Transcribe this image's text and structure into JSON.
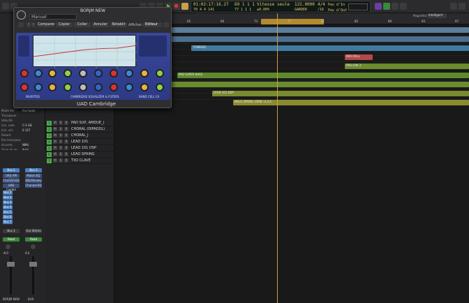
{
  "control_bar": {
    "lcd_time": "01:02:17:16.27",
    "lcd_time_sub": "70 4 4 141",
    "lcd_bars": "69 1 1 1",
    "lcd_bars_sub": "77 1 1 1",
    "lcd_mode": "Vitesse seule",
    "lcd_mode_sub": "±0.00%",
    "lcd_tempo": "122.0000",
    "lcd_tempo_sub": "GARDER",
    "lcd_sig": "4/4",
    "lcd_sig_sub": "/16",
    "lcd_in": "Pas d'In",
    "lcd_out": "Pas d'Out",
    "snap_label": "Magnétisme",
    "snap_value": "Intelligent"
  },
  "plugin": {
    "preset_name": "Manuel",
    "top_title": "BORJM NEW",
    "menu": [
      "Comparer",
      "Copier",
      "Coller",
      "Annuler",
      "Rétablir"
    ],
    "view_label": "Afficher :",
    "view_value": "Éditeur",
    "brand": "UAD Cambridge",
    "badge_1": "INVERTED",
    "badge_2": "CAMBRIDGE EQUALIZER & FILTERS",
    "badge_3": "BAND CELL CA",
    "knob_colors": [
      "#d33",
      "#3a8ad8",
      "#e7b341",
      "#8fd14f",
      "#bcbcbc",
      "#36c",
      "#d33",
      "#3a8ad8",
      "#e7b341",
      "#8fd14f"
    ]
  },
  "inspector": {
    "rows": [
      {
        "label": "Mode Vel",
        "value": "Pro-Fader"
      },
      {
        "label": "Transposer",
        "value": ""
      },
      {
        "label": "Vélocité",
        "value": ""
      },
      {
        "label": "Lim. note",
        "value": "C-2 G8"
      },
      {
        "label": "Lim. vél.",
        "value": "0 127"
      },
      {
        "label": "Retard",
        "value": ""
      },
      {
        "label": "Pas transpose",
        "value": ""
      },
      {
        "label": "Accords",
        "value": "NMU"
      },
      {
        "label": "Style de jeu",
        "value": "Auto"
      },
      {
        "label": "Arr. de tenue",
        "value": ""
      }
    ]
  },
  "tracks": [
    {
      "num": "1",
      "name": "PAD SUP, AMDUE_)"
    },
    {
      "num": "2",
      "name": "CHORAL (DIPADDL)"
    },
    {
      "num": "3",
      "name": "CHORAL_J"
    },
    {
      "num": "4",
      "name": "LEAD 101"
    },
    {
      "num": "5",
      "name": "LEAD 101 DSP"
    },
    {
      "num": "6",
      "name": "LEAD SPRING"
    },
    {
      "num": "7",
      "name": "TXO CLAVE"
    }
  ],
  "ruler": [
    "57",
    "61",
    "65",
    "69",
    "73",
    "77",
    "81",
    "85",
    "89",
    "93",
    "97"
  ],
  "clips": [
    {
      "lane": 0,
      "start": 0,
      "end": 508,
      "color": "#5a7e9c",
      "label": ""
    },
    {
      "lane": 1,
      "start": 0,
      "end": 508,
      "color": "#4b6f8f",
      "label": "BDR KK - Pattern 3"
    },
    {
      "lane": 2,
      "start": 110,
      "end": 508,
      "color": "#3d7aa0",
      "label": "TOMBISE)"
    },
    {
      "lane": 3,
      "start": 330,
      "end": 370,
      "color": "#b14a4a",
      "label": "BRA ROLL"
    },
    {
      "lane": 4,
      "start": 330,
      "end": 508,
      "color": "#6c8a2e",
      "label": "PAD OAK 2"
    },
    {
      "lane": 5,
      "start": 90,
      "end": 508,
      "color": "#5e8a2c",
      "label": "PAD SUPER BASS"
    },
    {
      "lane": 6,
      "start": 20,
      "end": 508,
      "color": "#6a8c2e",
      "label": "LEAD 101 B"
    },
    {
      "lane": 7,
      "start": 140,
      "end": 508,
      "color": "#7a8a2e",
      "label": "LEAD 101 DSP"
    },
    {
      "lane": 8,
      "start": 170,
      "end": 508,
      "color": "#8a8a30",
      "label": "MELO SPRING VERB +L3.4"
    }
  ],
  "strips": {
    "left": {
      "name": "BORJM NEW",
      "insert1": "Bus 2",
      "plugins": [
        "UAD API 550",
        "Channel EQ",
        "UAD Cambri"
      ],
      "sends": [
        "Bus 1",
        "Bus 2",
        "Bus 3",
        "Bus 4",
        "Bus 5",
        "Bus 6",
        "Bus 7"
      ],
      "out": "Bus 3",
      "auto": "Read",
      "vol": "-6.0",
      "pan": "-1.1"
    },
    "right": {
      "name": "BUS",
      "insert1": "Bus 3",
      "plugins": [
        "Match EQ",
        "DELMonkey",
        "Channel EQ"
      ],
      "out": "Out Stéréo",
      "auto": "Read",
      "vol": "0.0",
      "pan": "0"
    }
  }
}
